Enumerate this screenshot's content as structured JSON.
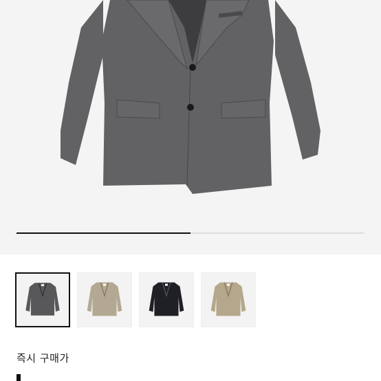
{
  "product": {
    "main_image": "gray-herringbone-wool-blazer",
    "gallery_progress": 0.5
  },
  "colors": {
    "accent": "#111111",
    "track": "#dddddd",
    "background": "#f4f4f4"
  },
  "color_options": [
    {
      "name": "charcoal-gray",
      "swatch": "#5a5a5c",
      "selected": true
    },
    {
      "name": "beige",
      "swatch": "#b3a892",
      "selected": false
    },
    {
      "name": "black",
      "swatch": "#1f2026",
      "selected": false
    },
    {
      "name": "khaki",
      "swatch": "#b5a78c",
      "selected": false
    }
  ],
  "purchase": {
    "instant_buy_label": "즉시 구매가"
  }
}
